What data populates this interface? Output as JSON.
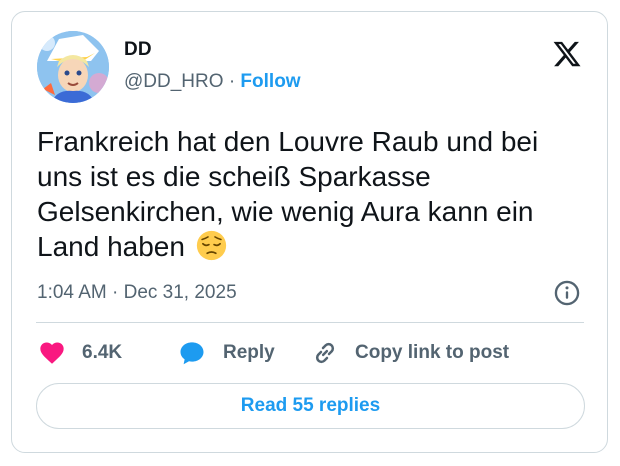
{
  "author": {
    "display_name": "DD",
    "handle": "@DD_HRO",
    "separator": "·",
    "follow_label": "Follow"
  },
  "tweet": {
    "text": "Frankreich hat den Louvre Raub und bei uns ist es die scheiß Sparkasse Gelsenkirchen, wie wenig Aura kann ein Land haben",
    "emoji": "pensive-face",
    "time": "1:04 AM",
    "date_separator": "·",
    "date": "Dec 31, 2025"
  },
  "actions": {
    "like_count": "6.4K",
    "reply_label": "Reply",
    "copy_link_label": "Copy link to post"
  },
  "read_replies_label": "Read 55 replies",
  "colors": {
    "accent": "#1d9bf0",
    "like": "#f91880",
    "secondary_text": "#536471",
    "border": "#cfd9de"
  }
}
